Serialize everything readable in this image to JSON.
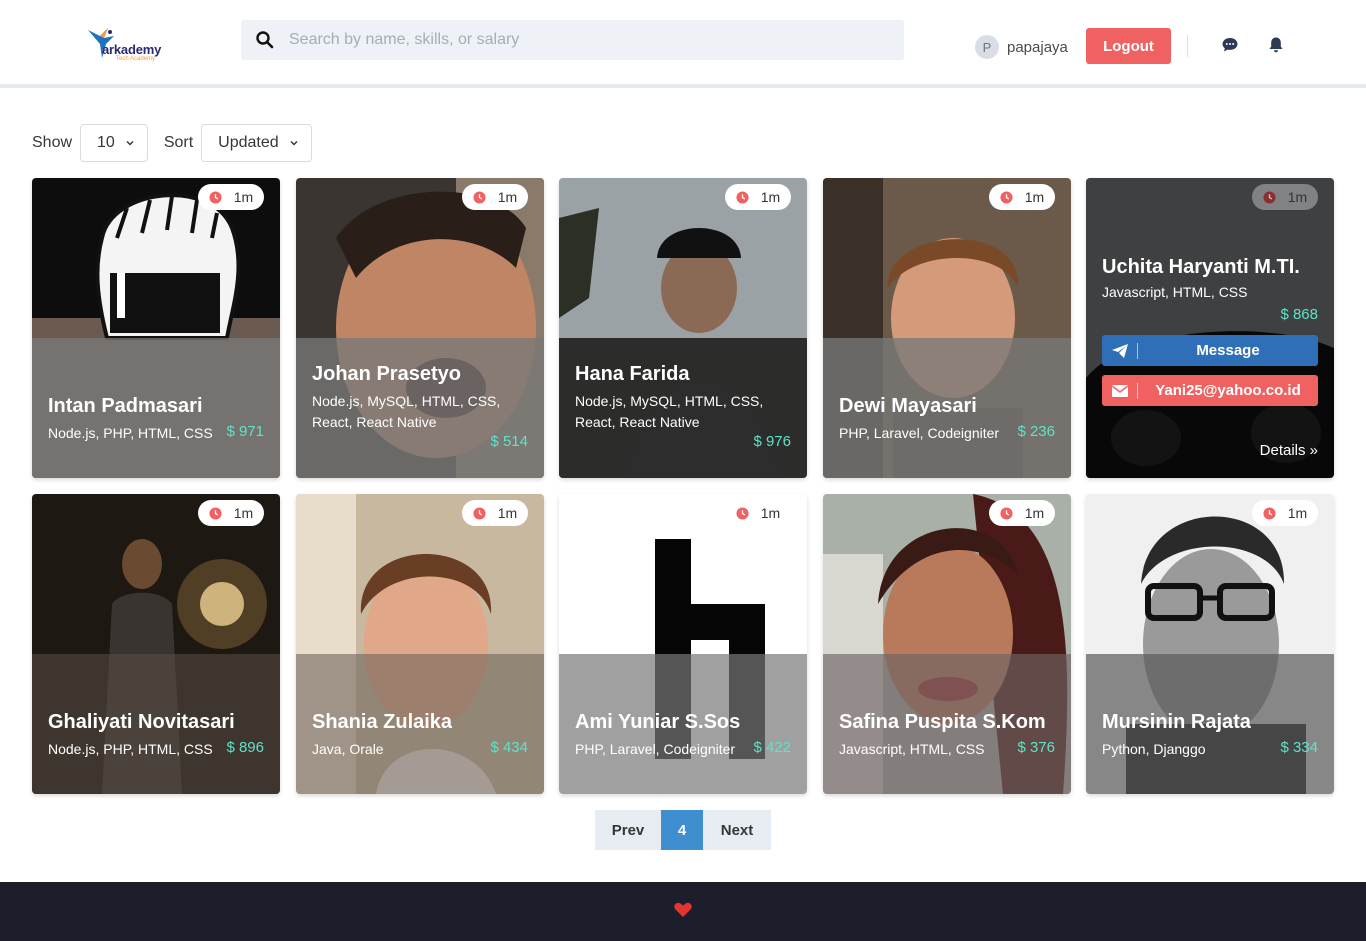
{
  "brand": {
    "name": "arkademy",
    "tagline": "Tech Academy"
  },
  "search": {
    "placeholder": "Search by name, skills, or salary",
    "value": ""
  },
  "user": {
    "initial": "P",
    "name": "papajaya"
  },
  "header": {
    "logout_label": "Logout"
  },
  "controls": {
    "show_label": "Show",
    "show_value": "10",
    "sort_label": "Sort",
    "sort_value": "Updated"
  },
  "cards": [
    {
      "name": "Intan Padmasari",
      "skills": "Node.js, PHP, HTML, CSS",
      "salary": "$ 971",
      "time": "1m"
    },
    {
      "name": "Johan Prasetyo",
      "skills": "Node.js, MySQL, HTML, CSS, React, React Native",
      "salary": "$ 514",
      "time": "1m"
    },
    {
      "name": "Hana Farida",
      "skills": "Node.js, MySQL, HTML, CSS, React, React Native",
      "salary": "$ 976",
      "time": "1m"
    },
    {
      "name": "Dewi Mayasari",
      "skills": "PHP, Laravel, Codeigniter",
      "salary": "$ 236",
      "time": "1m"
    },
    {
      "name": "Uchita Haryanti M.TI.",
      "skills": "Javascript, HTML, CSS",
      "salary": "$ 868",
      "time": "1m",
      "message_label": "Message",
      "email": "Yani25@yahoo.co.id",
      "details_label": "Details »"
    },
    {
      "name": "Ghaliyati Novitasari",
      "skills": "Node.js, PHP, HTML, CSS",
      "salary": "$ 896",
      "time": "1m"
    },
    {
      "name": "Shania Zulaika",
      "skills": "Java, Orale",
      "salary": "$ 434",
      "time": "1m"
    },
    {
      "name": "Ami Yuniar S.Sos",
      "skills": "PHP, Laravel, Codeigniter",
      "salary": "$ 422",
      "time": "1m"
    },
    {
      "name": "Safina Puspita S.Kom",
      "skills": "Javascript, HTML, CSS",
      "salary": "$ 376",
      "time": "1m"
    },
    {
      "name": "Mursinin Rajata",
      "skills": "Python, Djanggo",
      "salary": "$ 334",
      "time": "1m"
    }
  ],
  "pagination": {
    "prev_label": "Prev",
    "current": "4",
    "next_label": "Next"
  },
  "colors": {
    "accent_red": "#f06262",
    "accent_blue": "#3e8ed0",
    "salary_teal": "#5ee3c9",
    "footer_bg": "#1c1f2b",
    "message_btn": "#2f6fb7"
  }
}
